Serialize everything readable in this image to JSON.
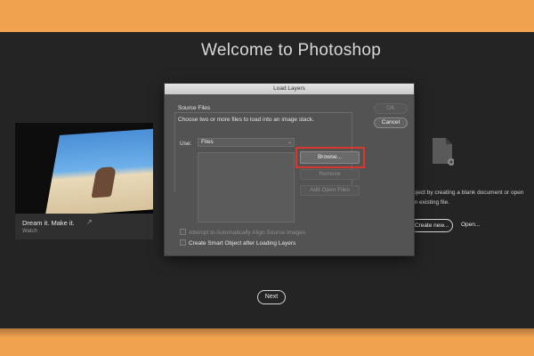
{
  "background": {
    "frame_color": "#f0a24e",
    "screen_color": "#242424"
  },
  "welcome": {
    "title": "Welcome to Photoshop"
  },
  "card": {
    "title": "Dream it. Make it.",
    "subtitle": "Watch",
    "icon": "external-link-icon"
  },
  "right_panel": {
    "description": "roject by creating a blank document or open an existing file.",
    "create_new_label": "Create new...",
    "open_label": "Open..."
  },
  "next_label": "Next",
  "dialog": {
    "title": "Load Layers",
    "group_label": "Source Files",
    "description": "Choose two or more files to load into an image stack.",
    "use_label": "Use:",
    "use_value": "Files",
    "browse_label": "Browse...",
    "remove_label": "Remove",
    "add_open_label": "Add Open Files",
    "ok_label": "OK",
    "cancel_label": "Cancel",
    "checkbox_align": "Attempt to Automatically Align Source Images",
    "checkbox_smart": "Create Smart Object after Loading Layers",
    "highlight_color": "#d8372c"
  }
}
